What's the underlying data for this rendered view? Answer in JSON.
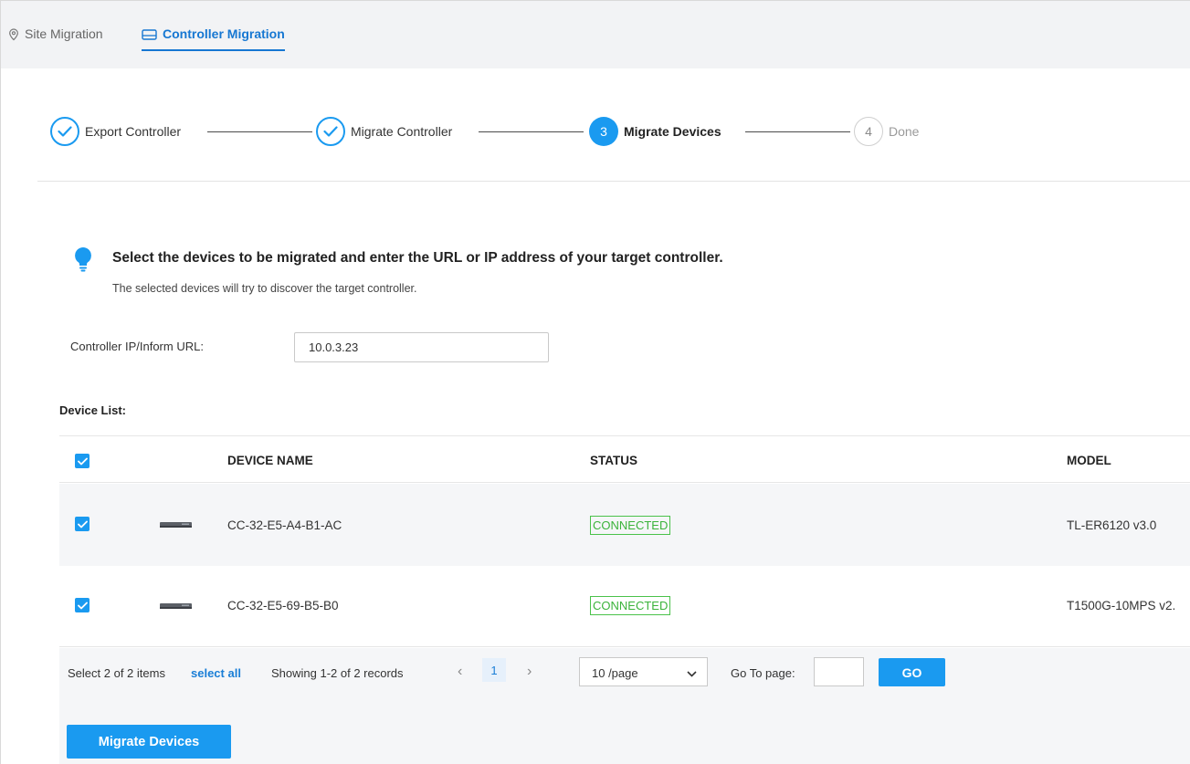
{
  "tabs": {
    "site": {
      "label": "Site Migration",
      "icon": "location-pin-icon"
    },
    "controller": {
      "label": "Controller Migration",
      "icon": "controller-icon",
      "active": true
    }
  },
  "steps": [
    {
      "number": "1",
      "label": "Export Controller",
      "state": "done"
    },
    {
      "number": "2",
      "label": "Migrate Controller",
      "state": "done"
    },
    {
      "number": "3",
      "label": "Migrate Devices",
      "state": "active"
    },
    {
      "number": "4",
      "label": "Done",
      "state": "todo"
    }
  ],
  "info": {
    "icon": "lightbulb-icon",
    "title": "Select the devices to be migrated and enter the URL or IP address of your target controller.",
    "subtitle": "The selected devices will try to discover the target controller."
  },
  "controller_ip": {
    "label": "Controller IP/Inform URL:",
    "value": "10.0.3.23"
  },
  "device_list": {
    "label": "Device List:",
    "columns": {
      "name": "DEVICE NAME",
      "status": "STATUS",
      "model": "MODEL"
    },
    "rows": [
      {
        "checked": true,
        "name": "CC-32-E5-A4-B1-AC",
        "status": "CONNECTED",
        "model": "TL-ER6120 v3.0"
      },
      {
        "checked": true,
        "name": "CC-32-E5-69-B5-B0",
        "status": "CONNECTED",
        "model": "T1500G-10MPS v2."
      }
    ]
  },
  "pagination": {
    "selected_text": "Select 2 of 2 items",
    "select_all": "select all",
    "showing": "Showing 1-2 of 2 records",
    "current_page": "1",
    "page_size": "10 /page",
    "goto_label": "Go To page:",
    "goto_value": "",
    "go_button": "GO"
  },
  "actions": {
    "migrate_button": "Migrate Devices"
  },
  "colors": {
    "accent": "#1a9af0",
    "link": "#1a7ed6",
    "connected": "#3bb33b",
    "active_row": "#f5f6f8"
  }
}
